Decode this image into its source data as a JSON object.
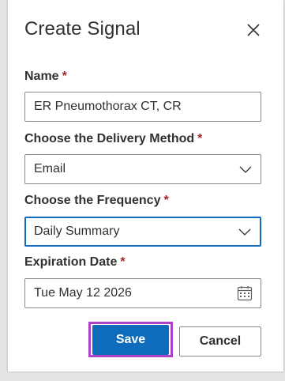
{
  "dialog": {
    "title": "Create Signal"
  },
  "form": {
    "name": {
      "label": "Name",
      "required_mark": "*",
      "value": "ER Pneumothorax CT, CR"
    },
    "delivery_method": {
      "label": "Choose the Delivery Method",
      "required_mark": "*",
      "value": "Email"
    },
    "frequency": {
      "label": "Choose the Frequency",
      "required_mark": "*",
      "value": "Daily Summary"
    },
    "expiration": {
      "label": "Expiration Date",
      "required_mark": "*",
      "value": "Tue May 12 2026"
    }
  },
  "actions": {
    "save_label": "Save",
    "cancel_label": "Cancel"
  },
  "icons": {
    "close": "close-icon",
    "dropdown": "chevron-down-icon",
    "calendar": "calendar-icon"
  },
  "colors": {
    "primary": "#0f6cbd",
    "required": "#a4262c",
    "highlight_outline": "#b040c8"
  }
}
